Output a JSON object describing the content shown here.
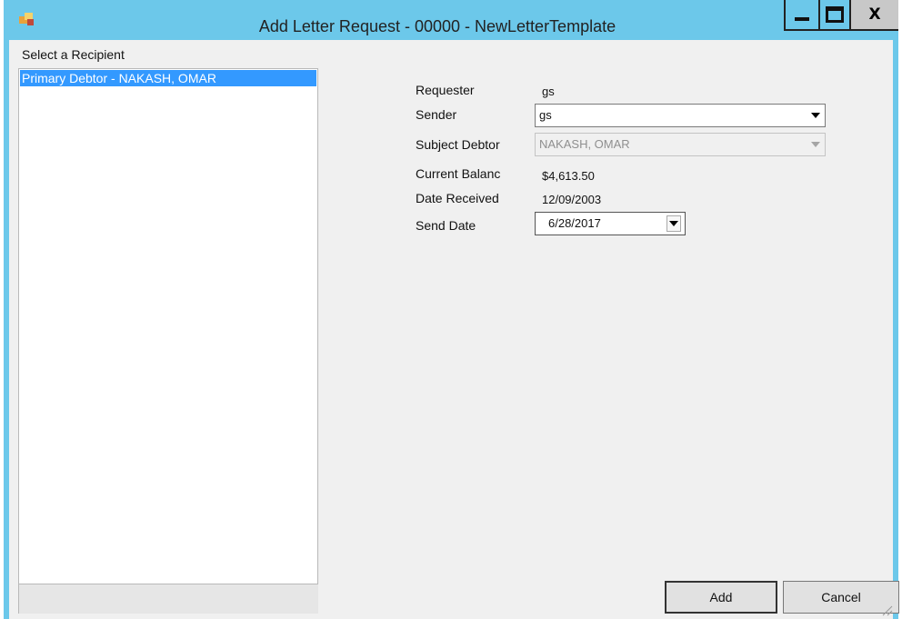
{
  "window": {
    "title": "Add Letter Request - 00000 - NewLetterTemplate",
    "close_glyph": "X"
  },
  "recipients": {
    "group_label": "Select a Recipient",
    "items": [
      {
        "label": "Primary Debtor - NAKASH, OMAR",
        "selected": true
      }
    ]
  },
  "form": {
    "requester": {
      "label": "Requester",
      "value": "gs"
    },
    "sender": {
      "label": "Sender",
      "value": "gs"
    },
    "subject_debtor": {
      "label": "Subject Debtor",
      "value": "NAKASH, OMAR",
      "enabled": false
    },
    "current_balance": {
      "label": "Current Balanc",
      "value": "$4,613.50"
    },
    "date_received": {
      "label": "Date Received",
      "value": "12/09/2003"
    },
    "send_date": {
      "label": "Send Date",
      "value": "6/28/2017"
    }
  },
  "buttons": {
    "add": "Add",
    "cancel": "Cancel"
  },
  "colors": {
    "titlebar": "#6cc8ea",
    "selection": "#3399ff",
    "dialog_bg": "#f0f0f0"
  },
  "icons": {
    "app": "app-icon",
    "minimize": "minimize-icon",
    "maximize": "maximize-icon",
    "close": "close-icon",
    "dropdown": "chevron-down-icon",
    "resize": "resize-grip-icon"
  }
}
